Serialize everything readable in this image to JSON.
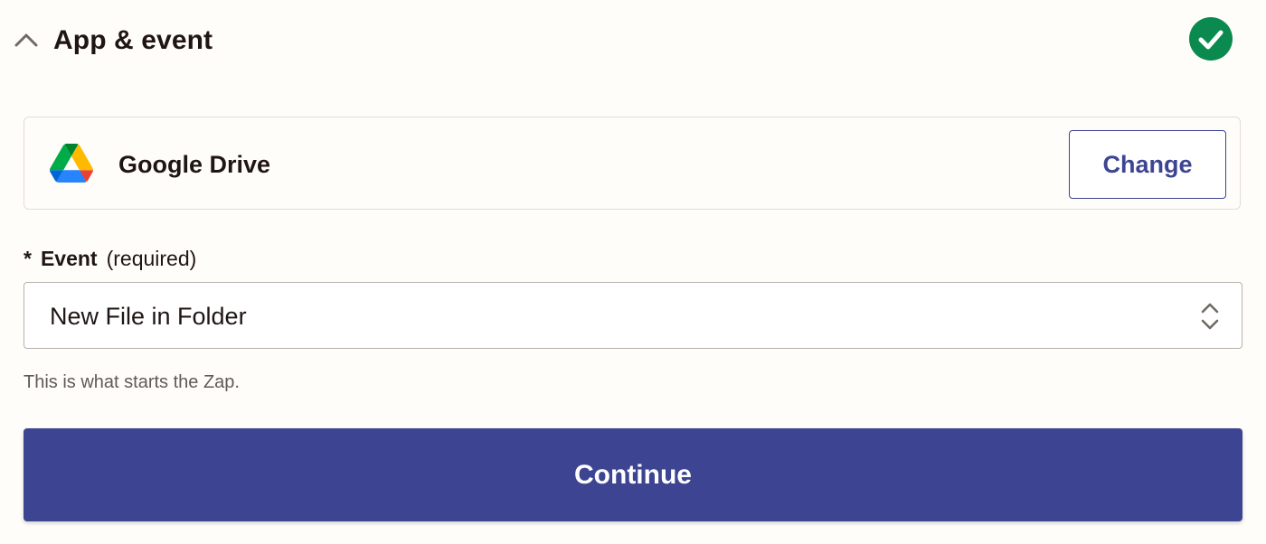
{
  "theme": {
    "accent": "#3d4592",
    "success": "#0a8a4f",
    "background": "#fffdf9"
  },
  "section": {
    "title": "App & event",
    "toggle_icon": "chevron-up-icon",
    "status_icon": "check-circle-icon",
    "status": "complete"
  },
  "app": {
    "name": "Google Drive",
    "logo": "google-drive-logo",
    "change_label": "Change"
  },
  "event_field": {
    "required_marker": "*",
    "label": "Event",
    "required_note": "(required)",
    "selected_value": "New File in Folder",
    "select_icon": "chevron-up-down-icon",
    "help_text": "This is what starts the Zap."
  },
  "actions": {
    "continue_label": "Continue"
  }
}
